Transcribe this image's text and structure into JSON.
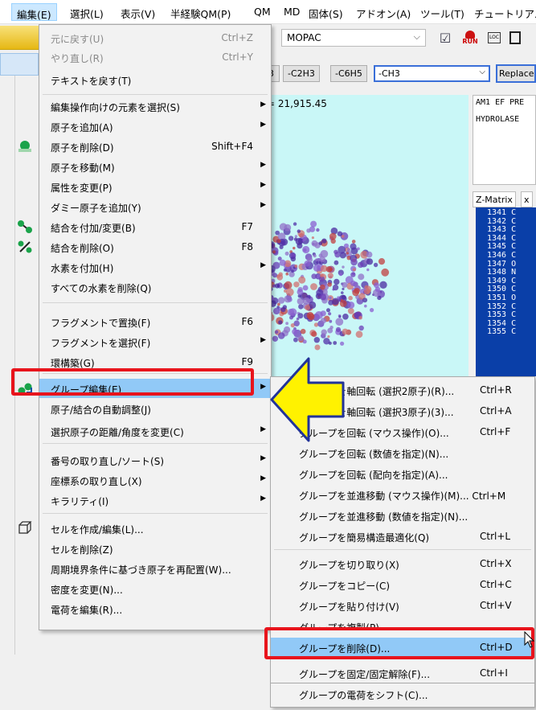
{
  "menubar": {
    "items": [
      "編集(E)",
      "選択(L)",
      "表示(V)",
      "半経験QM(P)",
      "QM",
      "MD",
      "固体(S)",
      "アドオン(A)",
      "ツール(T)",
      "チュートリアル"
    ]
  },
  "toolbar": {
    "method": "MOPAC",
    "run_label": "RUN",
    "loc_label": "LOC"
  },
  "fragments": {
    "buttons": [
      "3",
      "-C2H3",
      "-C6H5"
    ],
    "combo_value": "-CH3",
    "replace_label": "Replace"
  },
  "viewport": {
    "energy": "= 21,915.45"
  },
  "info_panel": {
    "lines": [
      "AM1 EF PRE",
      "HYDROLASE"
    ]
  },
  "zmatrix": {
    "tabs": [
      "Z-Matrix",
      "x"
    ],
    "rows": [
      "1341 C",
      "1342 C",
      "1343 C",
      "1344 C",
      "1345 C",
      "1346 C",
      "1347 O",
      "1348 N",
      "1349 C",
      "1350 C",
      "1351 O",
      "1352 C",
      "1353 C",
      "1354 C",
      "1355 C"
    ]
  },
  "edit_menu": {
    "items": [
      {
        "label": "元に戻す(U)",
        "shortcut": "Ctrl+Z"
      },
      {
        "label": "やり直し(R)",
        "shortcut": "Ctrl+Y"
      },
      {
        "label": "テキストを戻す(T)",
        "shortcut": ""
      },
      {
        "label": "編集操作向けの元素を選択(S)",
        "shortcut": ""
      },
      {
        "label": "原子を追加(A)",
        "shortcut": ""
      },
      {
        "label": "原子を削除(D)",
        "shortcut": "Shift+F4"
      },
      {
        "label": "原子を移動(M)",
        "shortcut": ""
      },
      {
        "label": "属性を変更(P)",
        "shortcut": ""
      },
      {
        "label": "ダミー原子を追加(Y)",
        "shortcut": ""
      },
      {
        "label": "結合を付加/変更(B)",
        "shortcut": "F7"
      },
      {
        "label": "結合を削除(O)",
        "shortcut": "F8"
      },
      {
        "label": "水素を付加(H)",
        "shortcut": ""
      },
      {
        "label": "すべての水素を削除(Q)",
        "shortcut": ""
      },
      {
        "label": "フラグメントで置換(F)",
        "shortcut": "F6"
      },
      {
        "label": "フラグメントを選択(F)",
        "shortcut": ""
      },
      {
        "label": "環構築(G)",
        "shortcut": "F9"
      },
      {
        "label": "グループ編集(E)",
        "shortcut": ""
      },
      {
        "label": "原子/結合の自動調整(J)",
        "shortcut": ""
      },
      {
        "label": "選択原子の距離/角度を変更(C)",
        "shortcut": ""
      },
      {
        "label": "番号の取り直し/ソート(S)",
        "shortcut": ""
      },
      {
        "label": "座標系の取り直し(X)",
        "shortcut": ""
      },
      {
        "label": "キラリティ(I)",
        "shortcut": ""
      },
      {
        "label": "セルを作成/編集(L)...",
        "shortcut": ""
      },
      {
        "label": "セルを削除(Z)",
        "shortcut": ""
      },
      {
        "label": "周期境界条件に基づき原子を再配置(W)...",
        "shortcut": ""
      },
      {
        "label": "密度を変更(N)...",
        "shortcut": ""
      },
      {
        "label": "電荷を編集(R)...",
        "shortcut": ""
      }
    ]
  },
  "group_submenu": {
    "items": [
      {
        "label": "グループを軸回転 (選択2原子)(R)...",
        "shortcut": "Ctrl+R"
      },
      {
        "label": "グループを軸回転 (選択3原子)(3)...",
        "shortcut": "Ctrl+A"
      },
      {
        "label": "グループを回転 (マウス操作)(O)...",
        "shortcut": "Ctrl+F"
      },
      {
        "label": "グループを回転 (数値を指定)(N)...",
        "shortcut": ""
      },
      {
        "label": "グループを回転 (配向を指定)(A)...",
        "shortcut": ""
      },
      {
        "label": "グループを並進移動 (マウス操作)(M)... Ctrl+M",
        "shortcut": ""
      },
      {
        "label": "グループを並進移動 (数値を指定)(N)...",
        "shortcut": ""
      },
      {
        "label": "グループを簡易構造最適化(Q)",
        "shortcut": "Ctrl+L"
      },
      {
        "label": "グループを切り取り(X)",
        "shortcut": "Ctrl+X"
      },
      {
        "label": "グループをコピー(C)",
        "shortcut": "Ctrl+C"
      },
      {
        "label": "グループを貼り付け(V)",
        "shortcut": "Ctrl+V"
      },
      {
        "label": "グループを複製(P)",
        "shortcut": ""
      },
      {
        "label": "グループを削除(D)...",
        "shortcut": "Ctrl+D"
      },
      {
        "label": "グループを固定/固定解除(F)...",
        "shortcut": "Ctrl+I"
      },
      {
        "label": "グループの電荷をシフト(C)...",
        "shortcut": ""
      }
    ]
  },
  "colors": {
    "highlight": "#91c9f7",
    "red_box": "#e8141c",
    "arrow_fill": "#fff200",
    "viewport_bg": "#c9f7f7"
  }
}
